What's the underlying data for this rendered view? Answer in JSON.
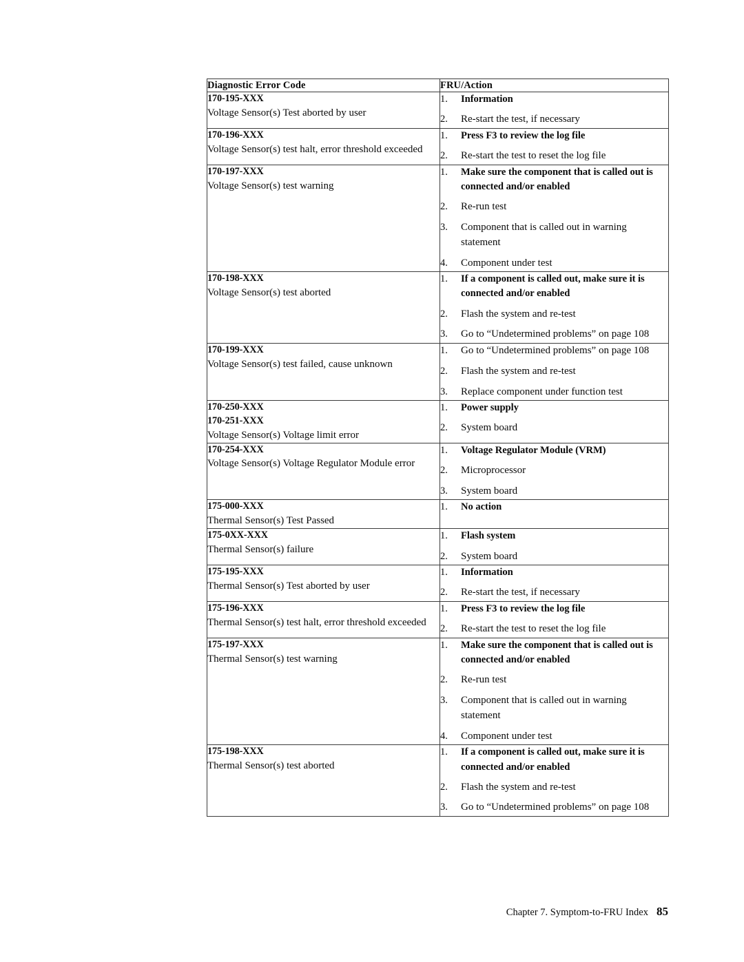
{
  "document": {
    "footer_chapter": "Chapter 7. Symptom-to-FRU Index",
    "page_number": "85"
  },
  "table": {
    "headers": {
      "col1": "Diagnostic Error Code",
      "col2": "FRU/Action"
    },
    "rows": [
      {
        "codes": [
          "170-195-XXX"
        ],
        "description": "Voltage Sensor(s) Test aborted by user",
        "actions": [
          {
            "text": "Information",
            "bold": true
          },
          {
            "text": "Re-start the test, if necessary",
            "bold": false
          }
        ]
      },
      {
        "codes": [
          "170-196-XXX"
        ],
        "description": "Voltage Sensor(s) test halt, error threshold exceeded",
        "actions": [
          {
            "text": "Press F3 to review the log file",
            "bold": true
          },
          {
            "text": "Re-start the test to reset the log file",
            "bold": false
          }
        ]
      },
      {
        "codes": [
          "170-197-XXX"
        ],
        "description": "Voltage Sensor(s) test warning",
        "actions": [
          {
            "text": "Make sure the component that is called out is connected and/or enabled",
            "bold": true
          },
          {
            "text": "Re-run test",
            "bold": false
          },
          {
            "text": "Component that is called out in warning statement",
            "bold": false
          },
          {
            "text": "Component under test",
            "bold": false
          }
        ]
      },
      {
        "codes": [
          "170-198-XXX"
        ],
        "description": "Voltage Sensor(s) test aborted",
        "actions": [
          {
            "text": "If a component is called out, make sure it is connected and/or enabled",
            "bold": true
          },
          {
            "text": "Flash the system and re-test",
            "bold": false
          },
          {
            "text": "Go to “Undetermined problems” on page 108",
            "bold": false
          }
        ]
      },
      {
        "codes": [
          "170-199-XXX"
        ],
        "description": "Voltage Sensor(s) test failed, cause unknown",
        "actions": [
          {
            "text": "Go to “Undetermined problems” on page 108",
            "bold": false
          },
          {
            "text": "Flash the system and re-test",
            "bold": false
          },
          {
            "text": "Replace component under function test",
            "bold": false
          }
        ]
      },
      {
        "codes": [
          "170-250-XXX",
          "170-251-XXX"
        ],
        "description": "Voltage Sensor(s) Voltage limit error",
        "actions": [
          {
            "text": "Power supply",
            "bold": true
          },
          {
            "text": "System board",
            "bold": false
          }
        ]
      },
      {
        "codes": [
          "170-254-XXX"
        ],
        "description": "Voltage Sensor(s) Voltage Regulator Module error",
        "actions": [
          {
            "text": "Voltage Regulator Module (VRM)",
            "bold": true
          },
          {
            "text": "Microprocessor",
            "bold": false
          },
          {
            "text": "System board",
            "bold": false
          }
        ]
      },
      {
        "codes": [
          "175-000-XXX"
        ],
        "description": "Thermal Sensor(s) Test Passed",
        "actions": [
          {
            "text": "No action",
            "bold": true
          }
        ]
      },
      {
        "codes": [
          "175-0XX-XXX"
        ],
        "description": "Thermal Sensor(s) failure",
        "actions": [
          {
            "text": "Flash system",
            "bold": true
          },
          {
            "text": "System board",
            "bold": false
          }
        ]
      },
      {
        "codes": [
          "175-195-XXX"
        ],
        "description": "Thermal Sensor(s) Test aborted by user",
        "actions": [
          {
            "text": "Information",
            "bold": true
          },
          {
            "text": "Re-start the test, if necessary",
            "bold": false
          }
        ]
      },
      {
        "codes": [
          "175-196-XXX"
        ],
        "description": "Thermal Sensor(s) test halt, error threshold exceeded",
        "actions": [
          {
            "text": "Press F3 to review the log file",
            "bold": true
          },
          {
            "text": "Re-start the test to reset the log file",
            "bold": false
          }
        ]
      },
      {
        "codes": [
          "175-197-XXX"
        ],
        "description": "Thermal Sensor(s) test warning",
        "actions": [
          {
            "text": "Make sure the component that is called out is connected and/or enabled",
            "bold": true
          },
          {
            "text": "Re-run test",
            "bold": false
          },
          {
            "text": "Component that is called out in warning statement",
            "bold": false
          },
          {
            "text": "Component under test",
            "bold": false
          }
        ]
      },
      {
        "codes": [
          "175-198-XXX"
        ],
        "description": "Thermal Sensor(s) test aborted",
        "actions": [
          {
            "text": "If a component is called out, make sure it is connected and/or enabled",
            "bold": true
          },
          {
            "text": "Flash the system and re-test",
            "bold": false
          },
          {
            "text": "Go to “Undetermined problems” on page 108",
            "bold": false
          }
        ]
      }
    ]
  }
}
